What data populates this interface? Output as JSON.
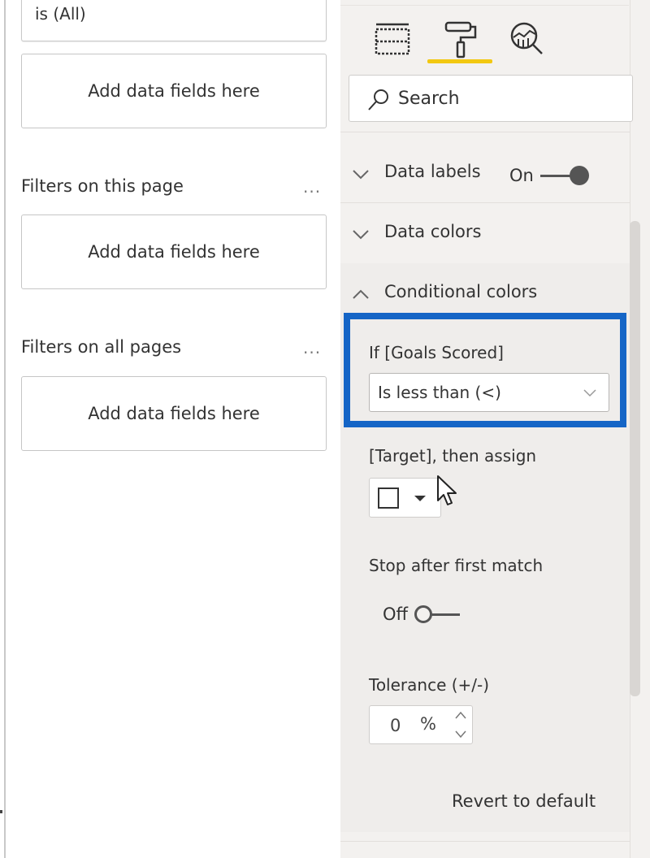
{
  "filters_pane": {
    "top_filter_card": {
      "condition": "is (All)"
    },
    "visual_drop_zone": "Add data fields here",
    "page_section": {
      "title": "Filters on this page",
      "more": "...",
      "drop_zone": "Add data fields here"
    },
    "all_pages_section": {
      "title": "Filters on all pages",
      "more": "...",
      "drop_zone": "Add data fields here"
    }
  },
  "format_pane": {
    "tabs": [
      {
        "name": "Fields",
        "icon": "fields-grid-icon",
        "active": false
      },
      {
        "name": "Format",
        "icon": "paint-roller-icon",
        "active": true
      },
      {
        "name": "Analytics",
        "icon": "analytics-magnifier-icon",
        "active": false
      }
    ],
    "active_tab_color": "#f2c811",
    "search": {
      "placeholder": "Search",
      "value": ""
    },
    "cards": [
      {
        "label": "Data labels",
        "expanded": false,
        "toggle": {
          "state": "On"
        }
      },
      {
        "label": "Data colors",
        "expanded": false
      },
      {
        "label": "Conditional colors",
        "expanded": true
      }
    ],
    "conditional_colors": {
      "condition_label": "If [Goals Scored]",
      "condition_operator": "Is less than (<)",
      "target_label": "[Target], then assign",
      "assign_color": "#ffffff",
      "stop_after_first_match": {
        "label": "Stop after first match",
        "state": "Off"
      },
      "tolerance": {
        "label": "Tolerance (+/-)",
        "value": "0",
        "unit": "%"
      },
      "revert_label": "Revert to default"
    },
    "highlight_color": "#1565c6"
  }
}
